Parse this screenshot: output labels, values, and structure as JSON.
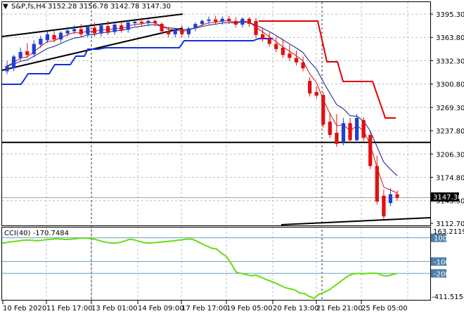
{
  "header": {
    "arrow": "▼",
    "symbol": "S&P,fs,H4",
    "ohlc": "3152.28 3156.78 3142.78 3147.30"
  },
  "price_axis": {
    "labels": [
      "3395.30",
      "3363.80",
      "3332.30",
      "3300.80",
      "3269.30",
      "3237.80",
      "3206.30",
      "3174.80",
      "3143.30",
      "3112.70"
    ],
    "current_price": "3147.30"
  },
  "time_axis": {
    "labels": [
      "10 Feb 2020",
      "11 Feb 17:00",
      "13 Feb 01:00",
      "14 Feb 09:00",
      "17 Feb 17:00",
      "19 Feb 05:00",
      "20 Feb 13:00",
      "21 Feb 21:00",
      "25 Feb 05:00"
    ]
  },
  "cci_panel": {
    "label": "CCI(40) -170.7484",
    "max_label": "163.2119",
    "min_label": "-411.5156",
    "levels": [
      "100",
      "-100",
      "-200"
    ]
  },
  "colors": {
    "bull": "#1f3fd6",
    "bear": "#e01010",
    "ma_dark": "#0a1a8a",
    "ma_red": "#cc1010",
    "stop_red": "#e00000",
    "support_blue": "#1030e0",
    "cci_line": "#66dd11",
    "level_line": "#6a9fc0",
    "grid": "#b8c0c8"
  },
  "chart_data": {
    "type": "candlestick",
    "ylim": [
      3112.7,
      3395.3
    ],
    "candles": [
      {
        "o": 3318,
        "h": 3332,
        "c": 3325
      },
      {
        "o": 3322,
        "h": 3340,
        "c": 3338
      },
      {
        "o": 3336,
        "h": 3350,
        "c": 3344
      },
      {
        "o": 3345,
        "h": 3356,
        "c": 3340
      },
      {
        "o": 3341,
        "h": 3360,
        "c": 3355
      },
      {
        "o": 3354,
        "h": 3366,
        "c": 3362
      },
      {
        "o": 3360,
        "h": 3372,
        "c": 3368
      },
      {
        "o": 3367,
        "h": 3374,
        "c": 3361
      },
      {
        "o": 3361,
        "h": 3372,
        "c": 3370
      },
      {
        "o": 3369,
        "h": 3378,
        "c": 3373
      },
      {
        "o": 3372,
        "h": 3380,
        "c": 3375
      },
      {
        "o": 3375,
        "h": 3382,
        "c": 3368
      },
      {
        "o": 3368,
        "h": 3380,
        "c": 3378
      },
      {
        "o": 3377,
        "h": 3384,
        "c": 3369
      },
      {
        "o": 3369,
        "h": 3382,
        "c": 3380
      },
      {
        "o": 3379,
        "h": 3386,
        "c": 3371
      },
      {
        "o": 3371,
        "h": 3383,
        "c": 3381
      },
      {
        "o": 3380,
        "h": 3387,
        "c": 3374
      },
      {
        "o": 3374,
        "h": 3386,
        "c": 3384
      },
      {
        "o": 3383,
        "h": 3389,
        "c": 3385
      },
      {
        "o": 3385,
        "h": 3390,
        "c": 3383
      },
      {
        "o": 3383,
        "h": 3388,
        "c": 3386
      },
      {
        "o": 3386,
        "h": 3388,
        "c": 3383
      },
      {
        "o": 3382,
        "h": 3384,
        "c": 3372
      },
      {
        "o": 3372,
        "h": 3378,
        "c": 3368
      },
      {
        "o": 3368,
        "h": 3376,
        "c": 3374
      },
      {
        "o": 3374,
        "h": 3380,
        "c": 3368
      },
      {
        "o": 3368,
        "h": 3378,
        "c": 3376
      },
      {
        "o": 3376,
        "h": 3384,
        "c": 3382
      },
      {
        "o": 3382,
        "h": 3388,
        "c": 3386
      },
      {
        "o": 3386,
        "h": 3392,
        "c": 3388
      },
      {
        "o": 3388,
        "h": 3393,
        "c": 3385
      },
      {
        "o": 3385,
        "h": 3392,
        "c": 3389
      },
      {
        "o": 3389,
        "h": 3393,
        "c": 3386
      },
      {
        "o": 3386,
        "h": 3391,
        "c": 3381
      },
      {
        "o": 3381,
        "h": 3391,
        "c": 3389
      },
      {
        "o": 3389,
        "h": 3391,
        "c": 3382
      },
      {
        "o": 3386,
        "h": 3390,
        "c": 3367
      },
      {
        "o": 3368,
        "h": 3376,
        "c": 3362
      },
      {
        "o": 3362,
        "h": 3370,
        "c": 3355
      },
      {
        "o": 3355,
        "h": 3364,
        "c": 3348
      },
      {
        "o": 3350,
        "h": 3362,
        "c": 3340
      },
      {
        "o": 3342,
        "h": 3354,
        "c": 3336
      },
      {
        "o": 3336,
        "h": 3346,
        "c": 3330
      },
      {
        "o": 3330,
        "h": 3338,
        "c": 3322
      },
      {
        "o": 3305,
        "h": 3310,
        "c": 3288
      },
      {
        "o": 3290,
        "h": 3298,
        "c": 3285
      },
      {
        "o": 3286,
        "h": 3290,
        "c": 3246
      },
      {
        "o": 3250,
        "h": 3262,
        "c": 3232
      },
      {
        "o": 3235,
        "h": 3260,
        "c": 3220
      },
      {
        "o": 3222,
        "h": 3255,
        "c": 3248
      },
      {
        "o": 3248,
        "h": 3255,
        "c": 3225
      },
      {
        "o": 3225,
        "h": 3260,
        "c": 3255
      },
      {
        "o": 3252,
        "h": 3256,
        "c": 3228
      },
      {
        "o": 3232,
        "h": 3236,
        "c": 3190
      },
      {
        "o": 3190,
        "h": 3204,
        "c": 3142
      },
      {
        "o": 3150,
        "h": 3158,
        "c": 3122
      },
      {
        "o": 3140,
        "h": 3160,
        "c": 3152
      },
      {
        "o": 3152,
        "h": 3157,
        "c": 3147
      }
    ],
    "cci": [
      55,
      60,
      68,
      72,
      78,
      82,
      80,
      76,
      78,
      85,
      88,
      92,
      90,
      86,
      88,
      92,
      96,
      98,
      94,
      88,
      76,
      64,
      58,
      54,
      60,
      72,
      86,
      84,
      72,
      60,
      56,
      58,
      62,
      66,
      70,
      74,
      80,
      84,
      90,
      88,
      70,
      48,
      30,
      12,
      5,
      -30,
      -60,
      -120,
      -190,
      -200,
      -210,
      -220,
      -215,
      -230,
      -250,
      -265,
      -280,
      -300,
      -320,
      -330,
      -340,
      -365,
      -370,
      -395,
      -410,
      -375,
      -360,
      -340,
      -310,
      -280,
      -250,
      -220,
      -205,
      -200,
      -205,
      -200,
      -198,
      -200,
      -218,
      -222,
      -210,
      -200
    ]
  }
}
